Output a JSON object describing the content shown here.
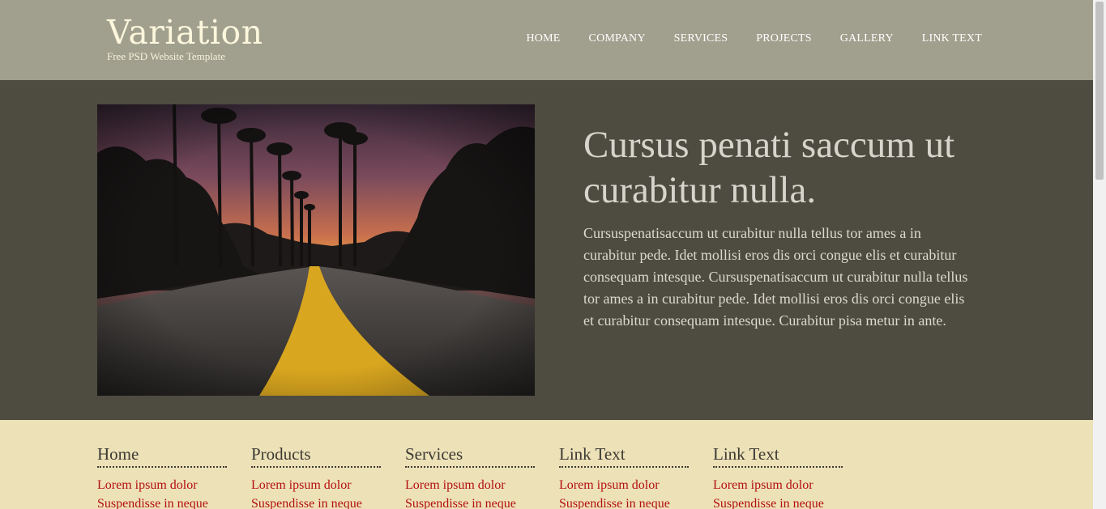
{
  "header": {
    "logo_title": "Variation",
    "logo_tagline": "Free PSD Website Template",
    "nav": [
      {
        "label": "HOME"
      },
      {
        "label": "COMPANY"
      },
      {
        "label": "SERVICES"
      },
      {
        "label": "PROJECTS"
      },
      {
        "label": "GALLERY"
      },
      {
        "label": "LINK TEXT"
      }
    ]
  },
  "hero": {
    "image_description": "sunset-road-palms",
    "heading": "Cursus penati saccum ut curabitur nulla.",
    "body": "Cursuspenatisaccum ut curabitur nulla tellus tor ames a in curabitur pede. Idet mollisi eros dis orci congue elis et curabitur consequam intesque. Cursuspenatisaccum ut curabitur nulla tellus tor ames a in curabitur pede. Idet mollisi eros dis orci congue elis et curabitur consequam intesque. Curabitur pisa metur in ante."
  },
  "footer": {
    "columns": [
      {
        "title": "Home",
        "links": [
          "Lorem ipsum dolor",
          "Suspendisse in neque"
        ]
      },
      {
        "title": "Products",
        "links": [
          "Lorem ipsum dolor",
          "Suspendisse in neque"
        ]
      },
      {
        "title": "Services",
        "links": [
          "Lorem ipsum dolor",
          "Suspendisse in neque"
        ]
      },
      {
        "title": "Link Text",
        "links": [
          "Lorem ipsum dolor",
          "Suspendisse in neque"
        ]
      },
      {
        "title": "Link Text",
        "links": [
          "Lorem ipsum dolor",
          "Suspendisse in neque"
        ]
      }
    ]
  },
  "colors": {
    "header_bg": "#a19f8d",
    "hero_bg": "#4e4b40",
    "footer_bg": "#ede1b8",
    "link_color": "#b30f0f"
  }
}
